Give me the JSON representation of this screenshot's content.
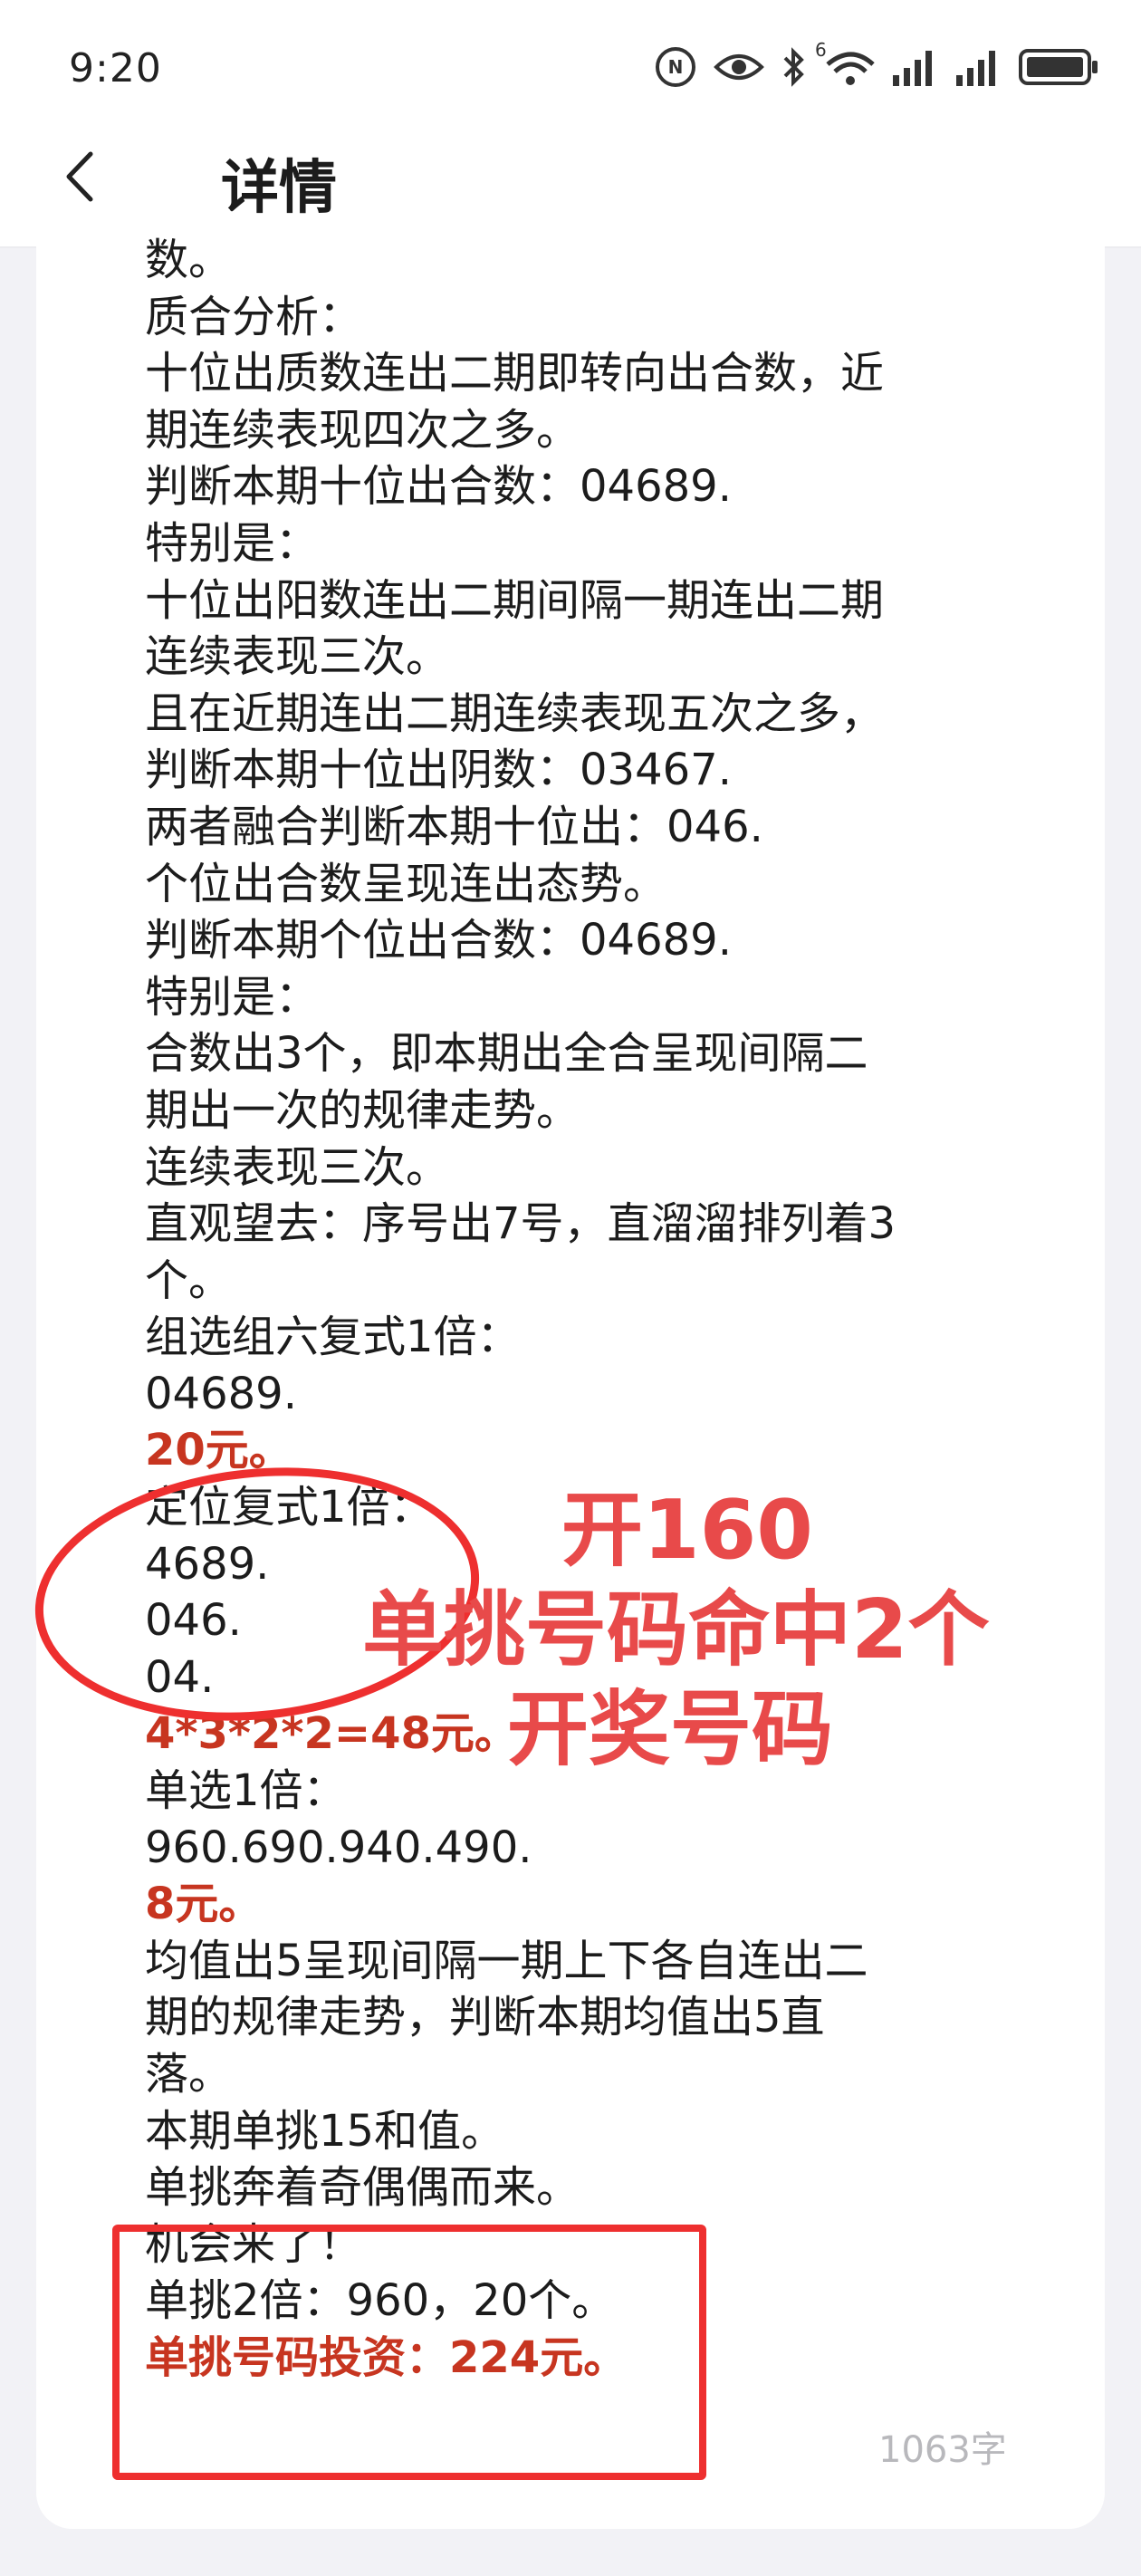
{
  "status_bar": {
    "time": "9:20",
    "icons": [
      "nfc-icon",
      "eye-icon",
      "bluetooth-icon",
      "wifi-icon",
      "signal-icon",
      "signal-icon",
      "battery-icon"
    ],
    "wifi_badge": "6"
  },
  "header": {
    "back_icon": "chevron-left-icon",
    "title": "详情"
  },
  "article": {
    "lines": [
      {
        "text": "数。",
        "style": "normal"
      },
      {
        "text": "质合分析：",
        "style": "normal"
      },
      {
        "text": "十位出质数连出二期即转向出合数，近",
        "style": "normal"
      },
      {
        "text": "期连续表现四次之多。",
        "style": "normal"
      },
      {
        "text": "判断本期十位出合数：04689.",
        "style": "normal"
      },
      {
        "text": "特别是：",
        "style": "normal"
      },
      {
        "text": "十位出阳数连出二期间隔一期连出二期",
        "style": "normal"
      },
      {
        "text": "连续表现三次。",
        "style": "normal"
      },
      {
        "text": "且在近期连出二期连续表现五次之多，",
        "style": "normal"
      },
      {
        "text": "判断本期十位出阴数：03467.",
        "style": "normal"
      },
      {
        "text": "两者融合判断本期十位出：046.",
        "style": "normal"
      },
      {
        "text": "个位出合数呈现连出态势。",
        "style": "normal"
      },
      {
        "text": "判断本期个位出合数：04689.",
        "style": "normal"
      },
      {
        "text": "特别是：",
        "style": "normal"
      },
      {
        "text": "合数出3个，即本期出全合呈现间隔二",
        "style": "normal"
      },
      {
        "text": "期出一次的规律走势。",
        "style": "normal"
      },
      {
        "text": "连续表现三次。",
        "style": "normal"
      },
      {
        "text": "直观望去：序号出7号，直溜溜排列着3",
        "style": "normal"
      },
      {
        "text": "个。",
        "style": "normal"
      },
      {
        "text": "组选组六复式1倍：",
        "style": "normal"
      },
      {
        "text": "04689.",
        "style": "normal"
      },
      {
        "text": "20元。",
        "style": "red"
      },
      {
        "text": "定位复式1倍：",
        "style": "normal"
      },
      {
        "text": "4689.",
        "style": "normal"
      },
      {
        "text": "046.",
        "style": "normal"
      },
      {
        "text": "04.",
        "style": "normal"
      },
      {
        "text": "4*3*2*2=48元。",
        "style": "red"
      },
      {
        "text": "单选1倍：",
        "style": "normal"
      },
      {
        "text": "960.690.940.490.",
        "style": "normal"
      },
      {
        "text": "8元。",
        "style": "red"
      },
      {
        "text": "均值出5呈现间隔一期上下各自连出二",
        "style": "normal"
      },
      {
        "text": "期的规律走势，判断本期均值出5直",
        "style": "normal"
      },
      {
        "text": "落。",
        "style": "normal"
      },
      {
        "text": "本期单挑15和值。",
        "style": "normal"
      },
      {
        "text": "单挑奔着奇偶偶而来。",
        "style": "normal"
      },
      {
        "text": "机会来了！",
        "style": "normal"
      },
      {
        "text": "单挑2倍：960，20个。",
        "style": "normal"
      },
      {
        "text": "单挑号码投资：224元。",
        "style": "red"
      }
    ],
    "word_count": "1063字"
  },
  "overlay": {
    "line1": "开160",
    "line2": "单挑号码命中2个",
    "line3": "开奖号码"
  },
  "colors": {
    "highlight_red": "#c73520",
    "annotation_red": "#ee2f2f",
    "overlay_text": "#e84a4a"
  }
}
